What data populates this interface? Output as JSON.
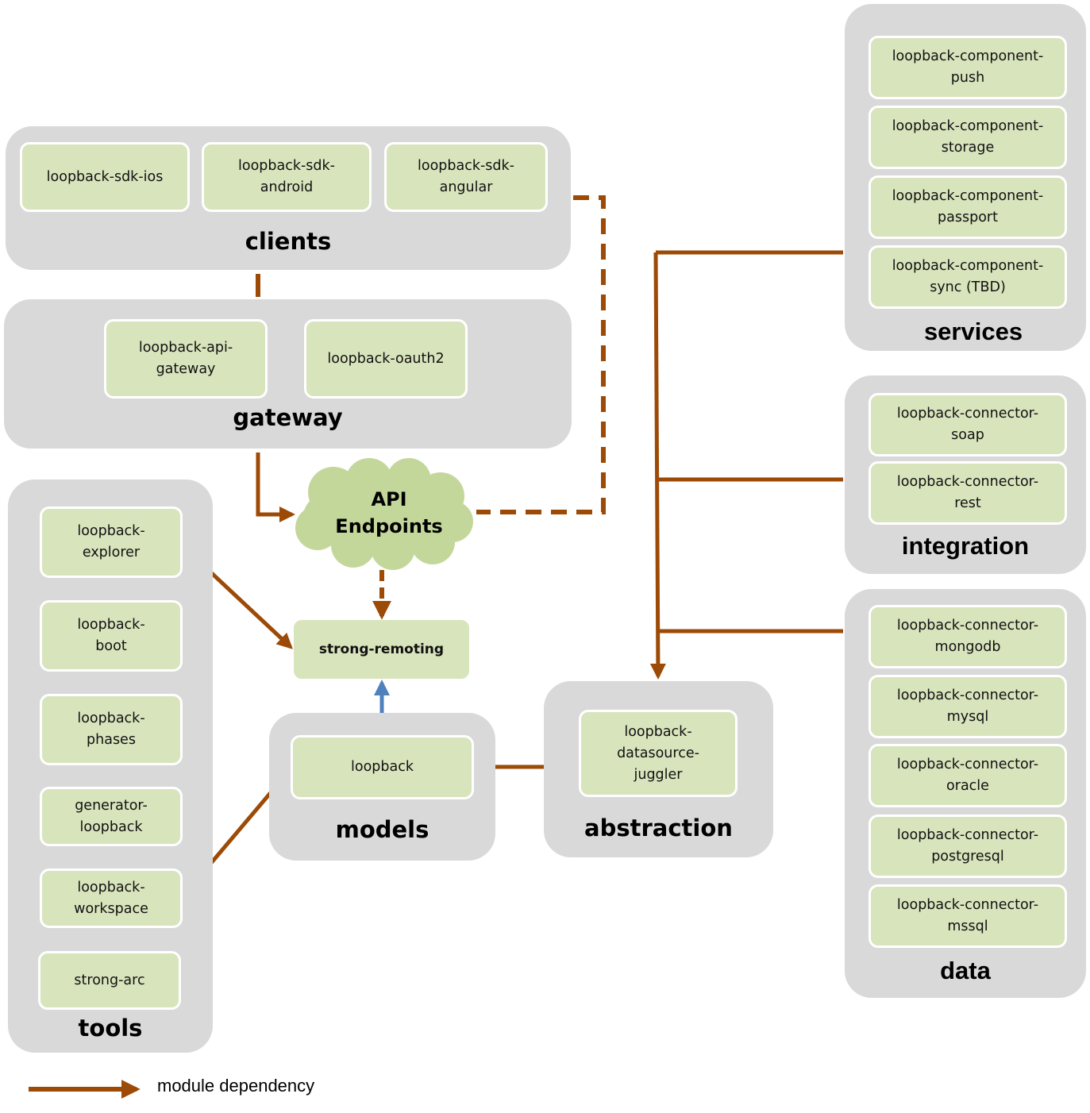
{
  "colors": {
    "group_bg": "#d9d9d9",
    "module_bg": "#d8e4bc",
    "cloud_bg": "#c4d79b",
    "dependency_arrow": "#9c4a06",
    "model_arrow": "#4f81bd"
  },
  "groups": {
    "clients": {
      "title": "clients",
      "modules": [
        "loopback-sdk-ios",
        "loopback-sdk-\nandroid",
        "loopback-sdk-\nangular"
      ]
    },
    "gateway": {
      "title": "gateway",
      "modules": [
        "loopback-api-\ngateway",
        "loopback-oauth2"
      ]
    },
    "tools": {
      "title": "tools",
      "modules": [
        "loopback-\nexplorer",
        "loopback-\nboot",
        "loopback-\nphases",
        "generator-\nloopback",
        "loopback-\nworkspace",
        "strong-arc"
      ]
    },
    "models": {
      "title": "models",
      "modules": [
        "loopback"
      ]
    },
    "abstraction": {
      "title": "abstraction",
      "modules": [
        "loopback-\ndatasource-\njuggler"
      ]
    },
    "services": {
      "title": "services",
      "modules": [
        "loopback-component-\npush",
        "loopback-component-\nstorage",
        "loopback-component-\npassport",
        "loopback-component-\nsync (TBD)"
      ]
    },
    "integration": {
      "title": "integration",
      "modules": [
        "loopback-connector-\nsoap",
        "loopback-connector-\nrest"
      ]
    },
    "data": {
      "title": "data",
      "modules": [
        "loopback-connector-\nmongodb",
        "loopback-connector-\nmysql",
        "loopback-connector-\noracle",
        "loopback-connector-\npostgresql",
        "loopback-connector-\nmssql"
      ]
    }
  },
  "standalone": {
    "api_endpoints": "API\nEndpoints",
    "strong_remoting": "strong-remoting"
  },
  "legend": {
    "label": "module dependency"
  }
}
